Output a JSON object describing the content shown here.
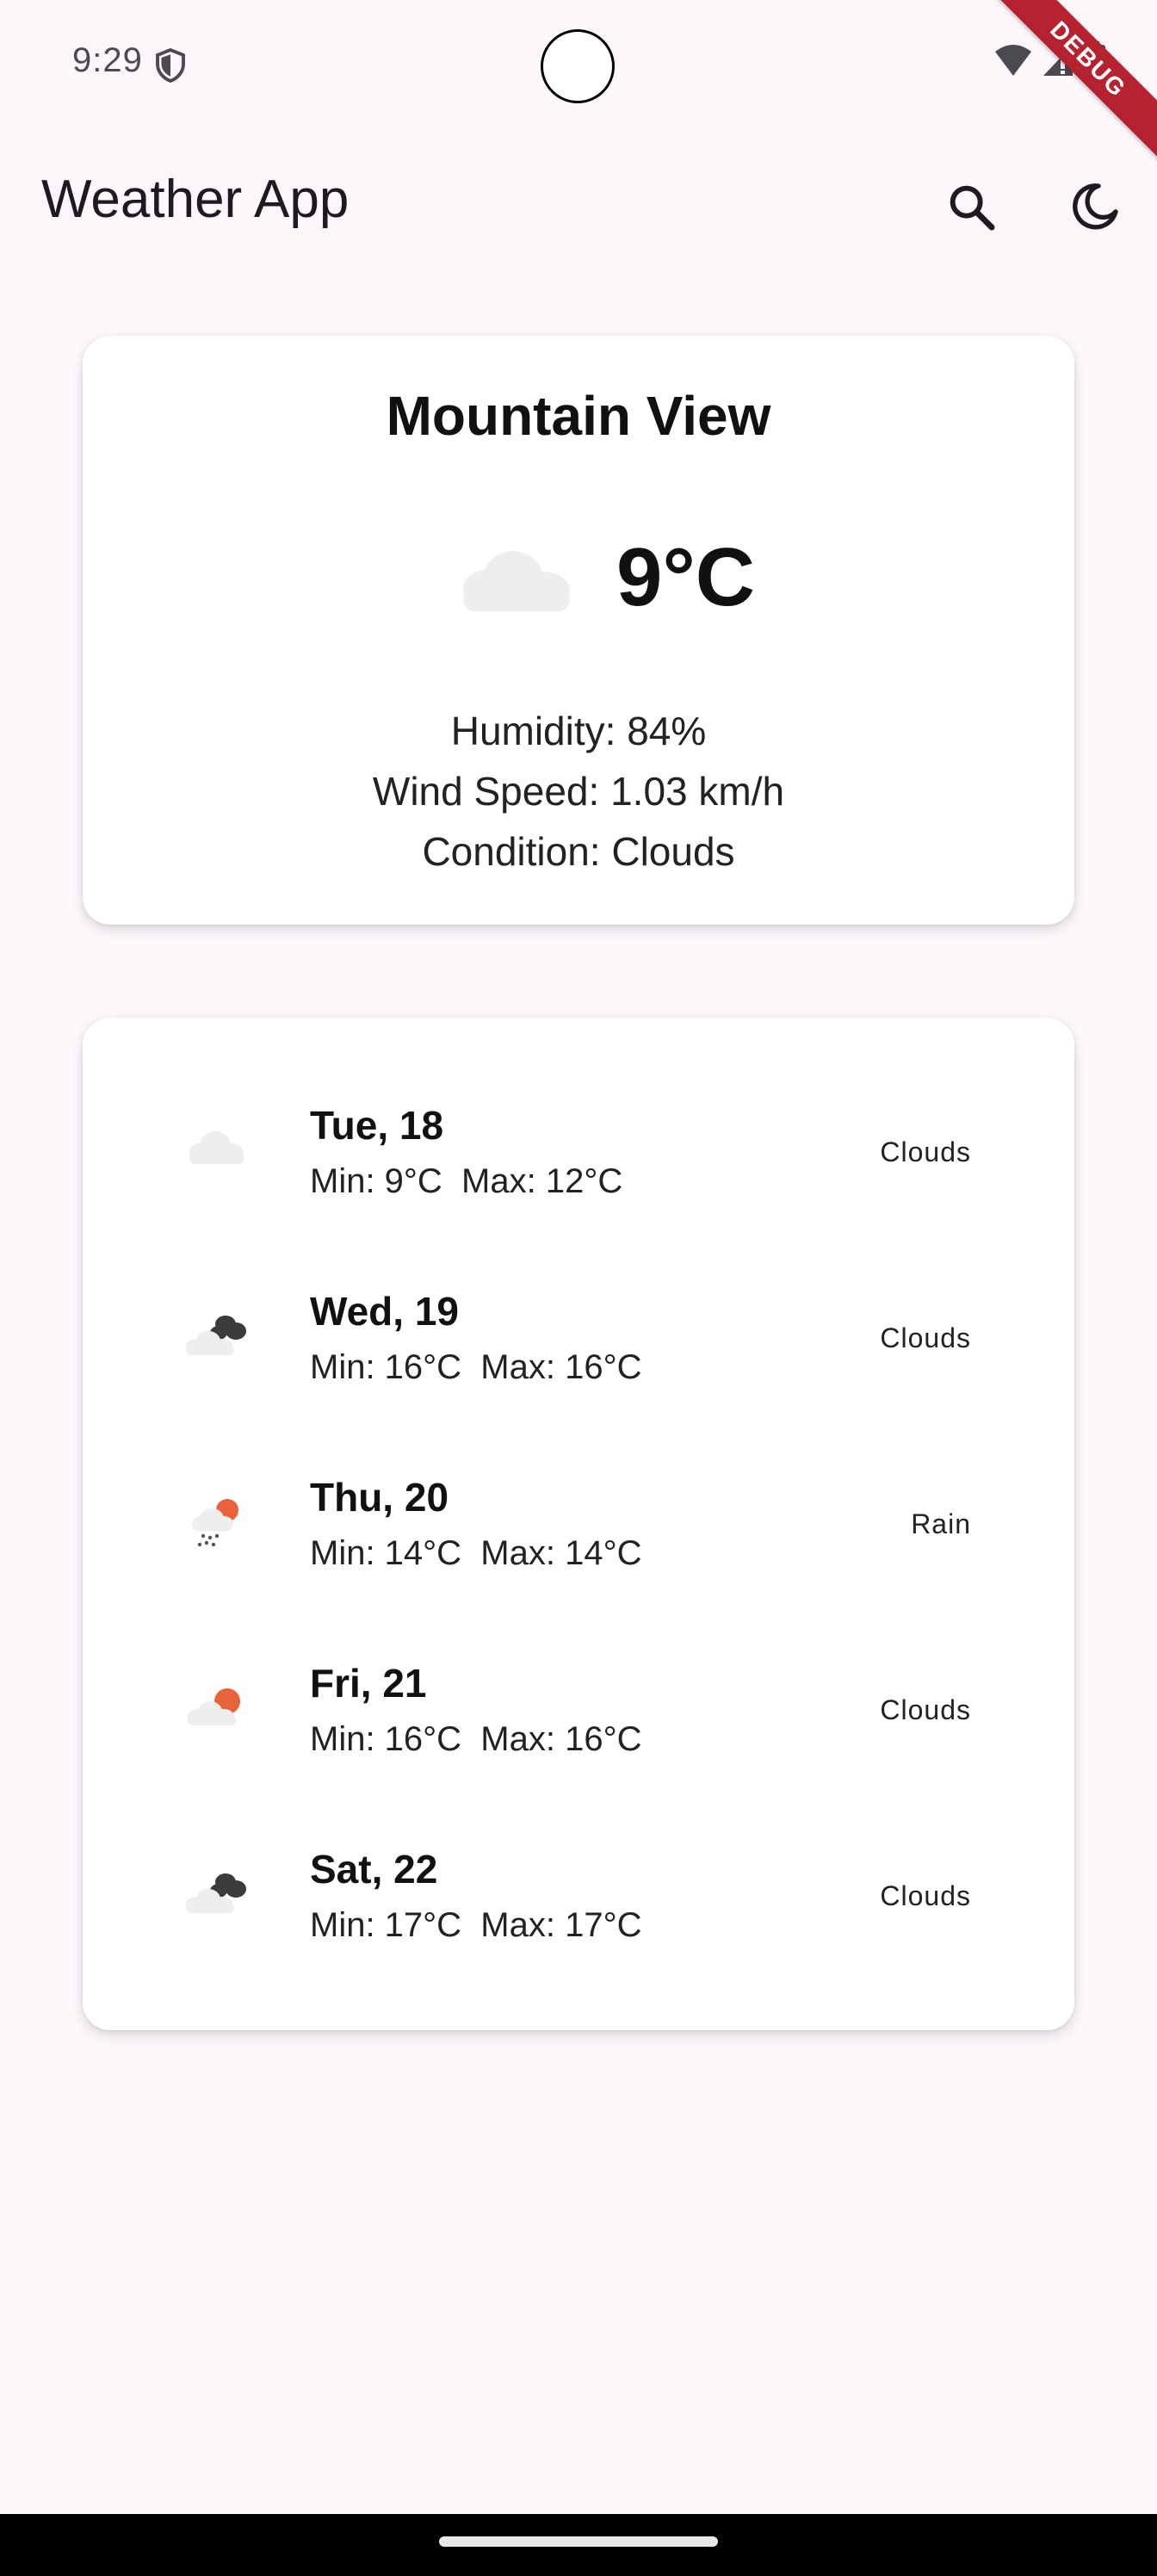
{
  "status_bar": {
    "time": "9:29",
    "debug_label": "DEBUG"
  },
  "app_bar": {
    "title": "Weather App",
    "search_icon": "search-icon",
    "theme_icon": "moon-icon"
  },
  "current": {
    "city": "Mountain View",
    "temperature": "9°C",
    "icon": "cloud-icon",
    "humidity": "Humidity: 84%",
    "wind_speed": "Wind Speed: 1.03 km/h",
    "condition": "Condition: Clouds"
  },
  "forecast": [
    {
      "date": "Tue, 18",
      "range": "Min: 9°C  Max: 12°C",
      "condition": "Clouds",
      "icon": "light-clouds-icon"
    },
    {
      "date": "Wed, 19",
      "range": "Min: 16°C  Max: 16°C",
      "condition": "Clouds",
      "icon": "broken-clouds-icon"
    },
    {
      "date": "Thu, 20",
      "range": "Min: 14°C  Max: 14°C",
      "condition": "Rain",
      "icon": "rain-sun-icon"
    },
    {
      "date": "Fri, 21",
      "range": "Min: 16°C  Max: 16°C",
      "condition": "Clouds",
      "icon": "sun-cloud-icon"
    },
    {
      "date": "Sat, 22",
      "range": "Min: 17°C  Max: 17°C",
      "condition": "Clouds",
      "icon": "broken-clouds-icon"
    }
  ],
  "colors": {
    "background": "#fdf7fc",
    "card": "#ffffff",
    "sun_accent": "#e8643c",
    "dark_cloud": "#3c3c3c",
    "light_cloud": "#eeeeee",
    "debug_banner": "#b4232f"
  }
}
